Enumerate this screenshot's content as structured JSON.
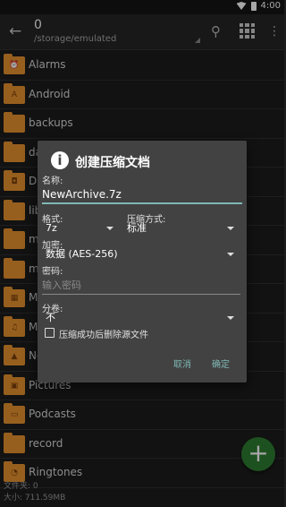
{
  "status_bar": {
    "time": "4:00"
  },
  "app_bar": {
    "count": "0",
    "path": "/storage/emulated"
  },
  "files": [
    {
      "name": "Alarms",
      "glyph": "⏰"
    },
    {
      "name": "Android",
      "glyph": "A"
    },
    {
      "name": "backups",
      "glyph": ""
    },
    {
      "name": "da",
      "glyph": ""
    },
    {
      "name": "DC",
      "glyph": "◘"
    },
    {
      "name": "lib",
      "glyph": ""
    },
    {
      "name": "m",
      "glyph": ""
    },
    {
      "name": "m",
      "glyph": ""
    },
    {
      "name": "M",
      "glyph": "▦"
    },
    {
      "name": "M",
      "glyph": "♫"
    },
    {
      "name": "No",
      "glyph": "▲"
    },
    {
      "name": "Pictures",
      "glyph": "▣"
    },
    {
      "name": "Podcasts",
      "glyph": "▭"
    },
    {
      "name": "record",
      "glyph": ""
    },
    {
      "name": "Ringtones",
      "glyph": "◔"
    }
  ],
  "bottom_info": {
    "folders": "文件夹: 0",
    "size": "大小:   711.59MB"
  },
  "fab": {
    "label": "+"
  },
  "dialog": {
    "title": "创建压缩文档",
    "name_label": "名称:",
    "name_value": "NewArchive.7z",
    "format_label": "格式:",
    "format_value": "7z",
    "compression_label": "压缩方式:",
    "compression_value": "标准",
    "encryption_label": "加密:",
    "encryption_value": "数据 (AES-256)",
    "password_label": "密码:",
    "password_placeholder": "输入密码",
    "split_label": "分卷:",
    "split_value": "不",
    "delete_source_label": "压缩成功后删除源文件",
    "cancel_label": "取消",
    "ok_label": "确定"
  }
}
